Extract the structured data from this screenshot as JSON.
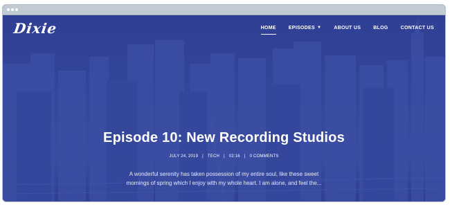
{
  "brand": {
    "logo_text": "Dixie"
  },
  "nav": {
    "items": [
      {
        "label": "HOME",
        "active": true
      },
      {
        "label": "EPISODES",
        "has_dropdown": true
      },
      {
        "label": "ABOUT US"
      },
      {
        "label": "BLOG"
      },
      {
        "label": "CONTACT US"
      }
    ]
  },
  "post": {
    "title": "Episode 10: New Recording Studios",
    "meta": {
      "date": "JULY 24, 2019",
      "category": "TECH",
      "duration": "02:16",
      "comments": "0 COMMENTS"
    },
    "excerpt_line1": "A wonderful serenity has taken possession of my entire soul, like these sweet",
    "excerpt_line2": "mornings of spring which I enjoy with my whole heart. I am alone, and feel the..."
  },
  "colors": {
    "hero_overlay": "#2f3f94",
    "window_chrome": "#c2cad4",
    "text": "#ffffff"
  },
  "icons": {
    "dropdown": "chevron-down-icon",
    "window_controls": "dot-icon"
  }
}
